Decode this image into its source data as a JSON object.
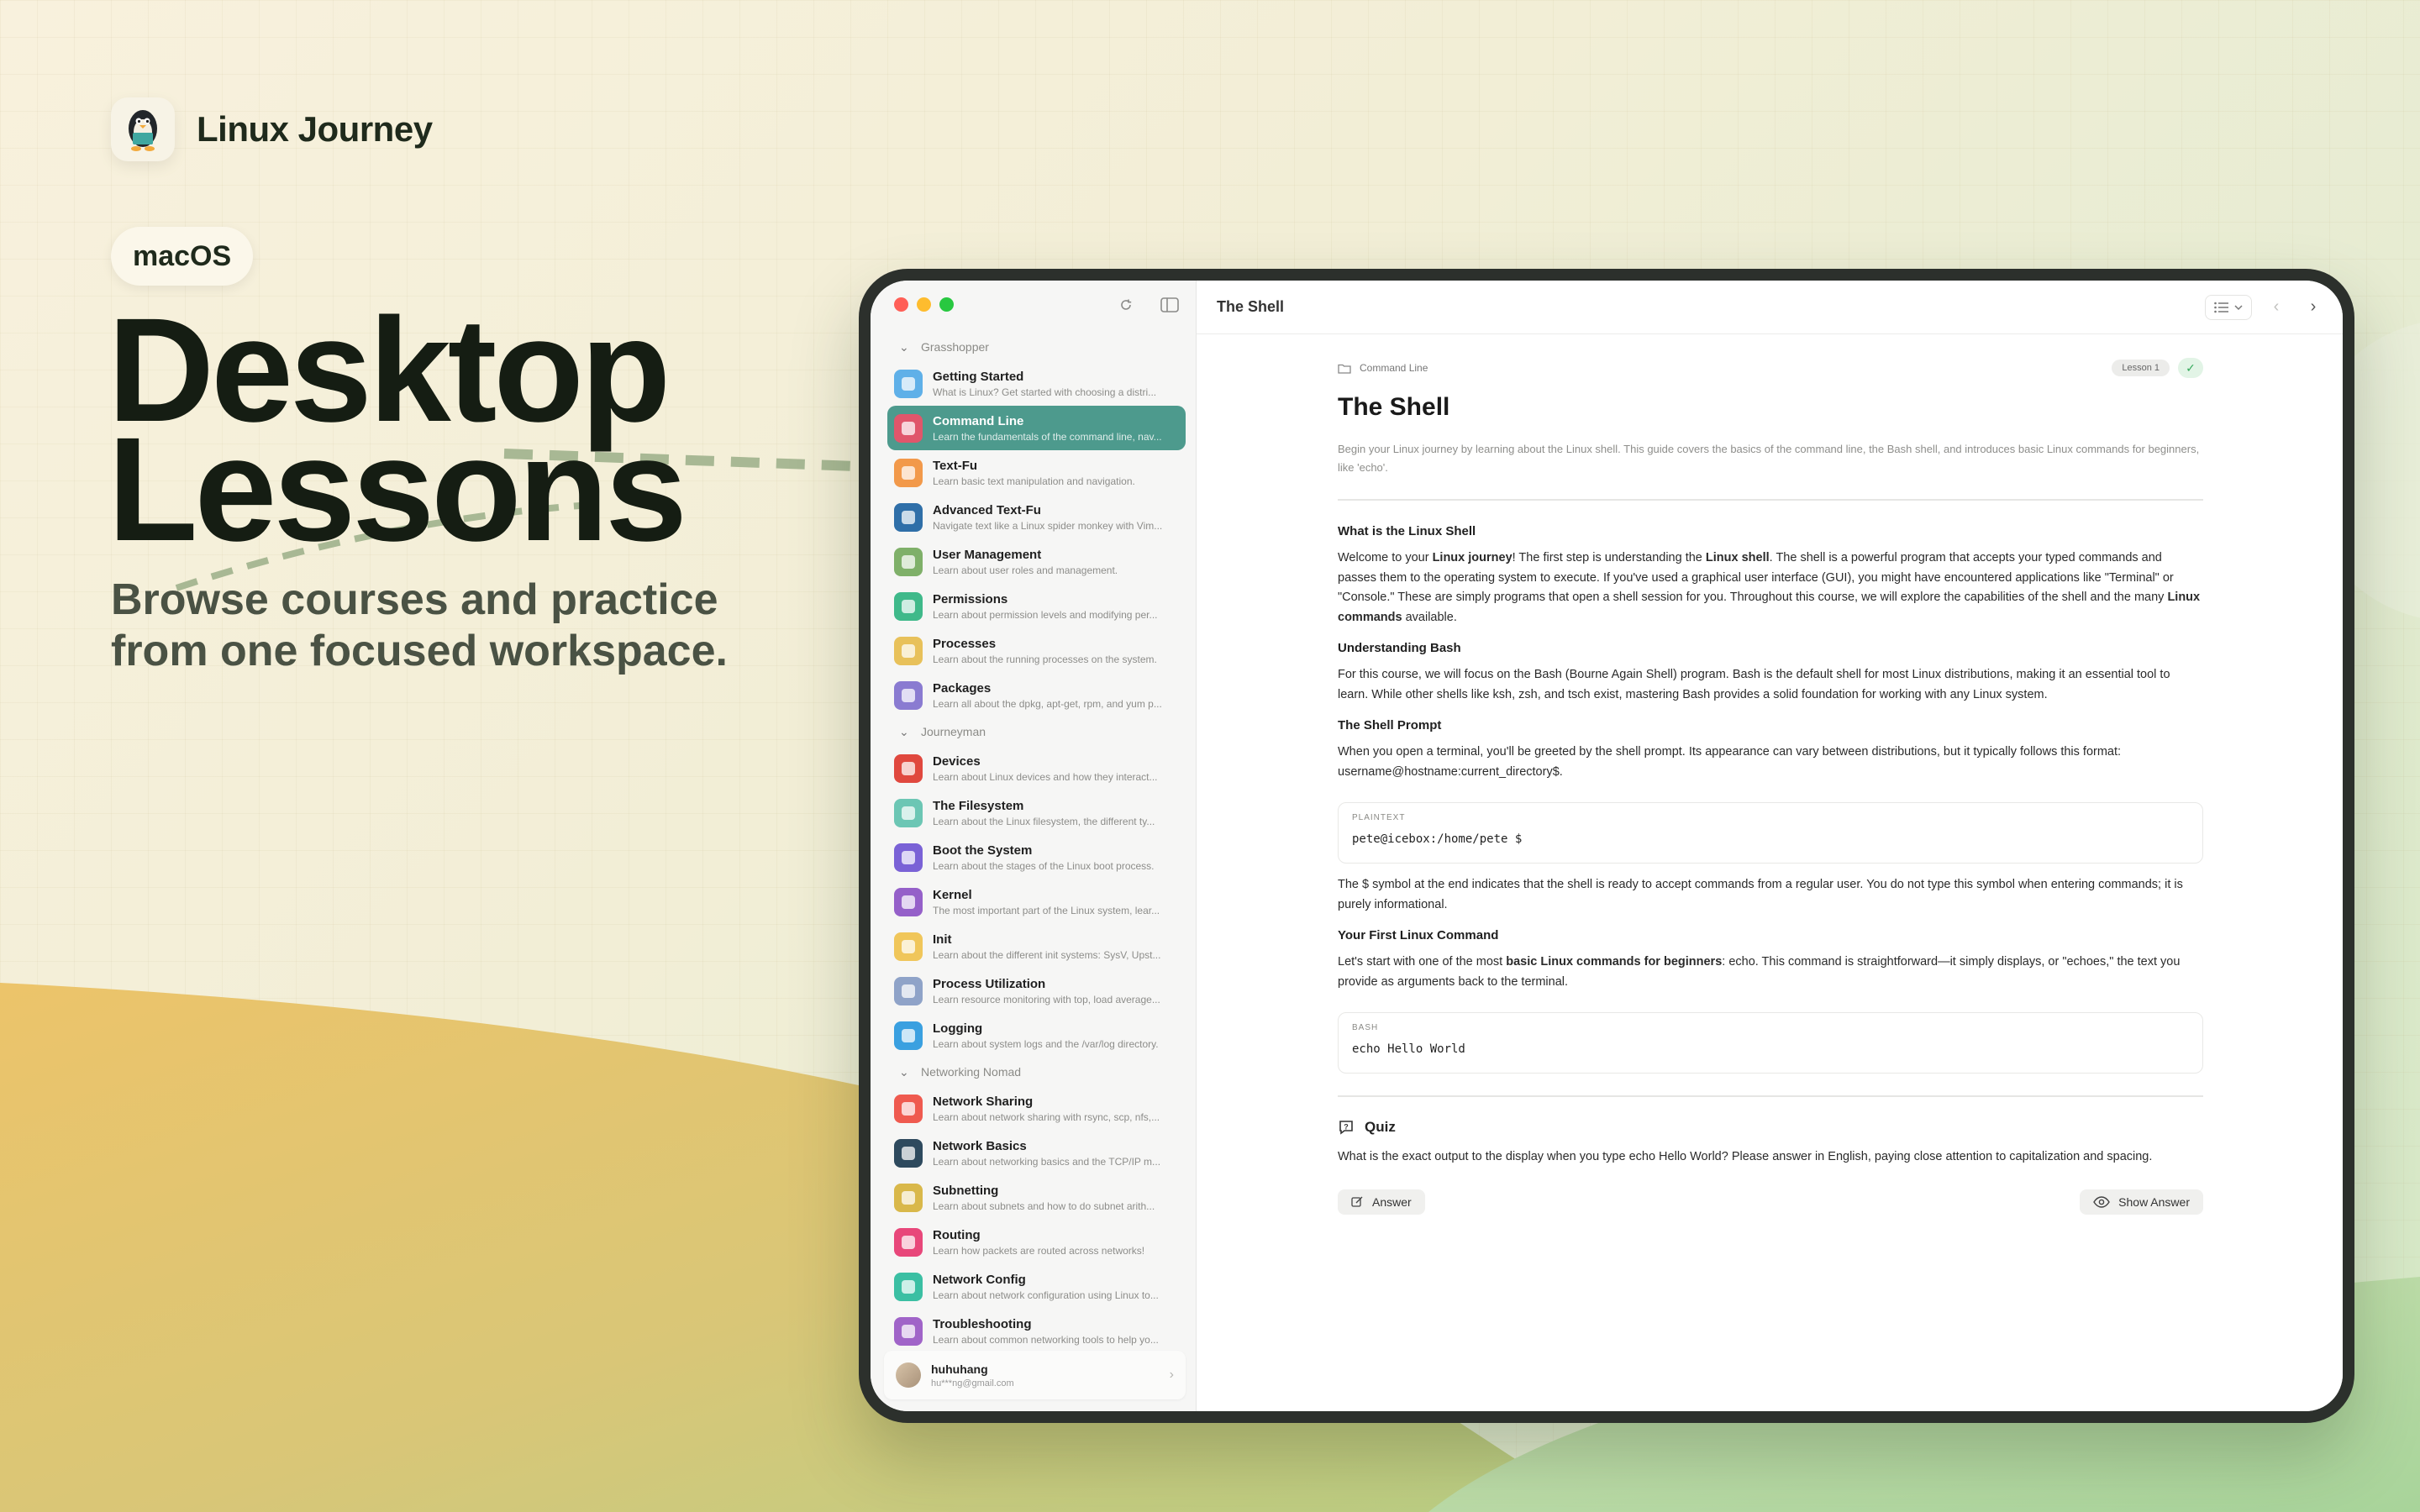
{
  "brand": {
    "name": "Linux Journey",
    "logo_icon": "penguin-icon"
  },
  "platform_badge": "macOS",
  "hero": {
    "title_line1": "Desktop",
    "title_line2": "Lessons",
    "subtitle": "Browse courses and practice from one focused workspace."
  },
  "sidebar": {
    "groups": [
      {
        "name": "Grasshopper",
        "lessons": [
          {
            "title": "Getting Started",
            "desc": "What is Linux? Get started with choosing a distri...",
            "color": "#5fb0e8"
          },
          {
            "title": "Command Line",
            "desc": "Learn the fundamentals of the command line, nav...",
            "color": "#e0566b",
            "active": true
          },
          {
            "title": "Text-Fu",
            "desc": "Learn basic text manipulation and navigation.",
            "color": "#f2994a"
          },
          {
            "title": "Advanced Text-Fu",
            "desc": "Navigate text like a Linux spider monkey with Vim...",
            "color": "#2f6fa8"
          },
          {
            "title": "User Management",
            "desc": "Learn about user roles and management.",
            "color": "#7fb069"
          },
          {
            "title": "Permissions",
            "desc": "Learn about permission levels and modifying per...",
            "color": "#3fb98a"
          },
          {
            "title": "Processes",
            "desc": "Learn about the running processes on the system.",
            "color": "#e8c15a"
          },
          {
            "title": "Packages",
            "desc": "Learn all about the dpkg, apt-get, rpm, and yum p...",
            "color": "#8a7bd1"
          }
        ]
      },
      {
        "name": "Journeyman",
        "lessons": [
          {
            "title": "Devices",
            "desc": "Learn about Linux devices and how they interact...",
            "color": "#e0483e"
          },
          {
            "title": "The Filesystem",
            "desc": "Learn about the Linux filesystem, the different ty...",
            "color": "#6cc6b4"
          },
          {
            "title": "Boot the System",
            "desc": "Learn about the stages of the Linux boot process.",
            "color": "#7a62d6"
          },
          {
            "title": "Kernel",
            "desc": "The most important part of the Linux system, lear...",
            "color": "#9560c9"
          },
          {
            "title": "Init",
            "desc": "Learn about the different init systems: SysV, Upst...",
            "color": "#f0c65a"
          },
          {
            "title": "Process Utilization",
            "desc": "Learn resource monitoring with top, load average...",
            "color": "#8fa3c8"
          },
          {
            "title": "Logging",
            "desc": "Learn about system logs and the /var/log directory.",
            "color": "#3aa0e0"
          }
        ]
      },
      {
        "name": "Networking Nomad",
        "lessons": [
          {
            "title": "Network Sharing",
            "desc": "Learn about network sharing with rsync, scp, nfs,...",
            "color": "#ef5a4f"
          },
          {
            "title": "Network Basics",
            "desc": "Learn about networking basics and the TCP/IP m...",
            "color": "#2e4a5e"
          },
          {
            "title": "Subnetting",
            "desc": "Learn about subnets and how to do subnet arith...",
            "color": "#d9b84a"
          },
          {
            "title": "Routing",
            "desc": "Learn how packets are routed across networks!",
            "color": "#e8477a"
          },
          {
            "title": "Network Config",
            "desc": "Learn about network configuration using Linux to...",
            "color": "#3bbfa3"
          },
          {
            "title": "Troubleshooting",
            "desc": "Learn about common networking tools to help yo...",
            "color": "#a064c8"
          }
        ]
      }
    ],
    "user": {
      "name": "huhuhang",
      "email": "hu***ng@gmail.com"
    }
  },
  "topbar": {
    "title": "The Shell"
  },
  "article": {
    "breadcrumb": "Command Line",
    "lesson_badge": "Lesson 1",
    "done_mark": "✓",
    "title": "The Shell",
    "intro": "Begin your Linux journey by learning about the Linux shell. This guide covers the basics of the command line, the Bash shell, and introduces basic Linux commands for beginners, like 'echo'.",
    "h_what": "What is the Linux Shell",
    "p_what_1": "Welcome to your ",
    "p_what_b1": "Linux journey",
    "p_what_2": "! The first step is understanding the ",
    "p_what_b2": "Linux shell",
    "p_what_3": ". The shell is a powerful program that accepts your typed commands and passes them to the operating system to execute. If you've used a graphical user interface (GUI), you might have encountered applications like \"Terminal\" or \"Console.\" These are simply programs that open a shell session for you. Throughout this course, we will explore the capabilities of the shell and the many ",
    "p_what_b3": "Linux commands",
    "p_what_4": " available.",
    "h_bash": "Understanding Bash",
    "p_bash": "For this course, we will focus on the Bash (Bourne Again Shell) program. Bash is the default shell for most Linux distributions, making it an essential tool to learn. While other shells like ksh, zsh, and tsch exist, mastering Bash provides a solid foundation for working with any Linux system.",
    "h_prompt": "The Shell Prompt",
    "p_prompt": "When you open a terminal, you'll be greeted by the shell prompt. Its appearance can vary between distributions, but it typically follows this format: username@hostname:current_directory$.",
    "code1_lang": "PLAINTEXT",
    "code1": "pete@icebox:/home/pete $",
    "p_symbol": "The $ symbol at the end indicates that the shell is ready to accept commands from a regular user. You do not type this symbol when entering commands; it is purely informational.",
    "h_first": "Your First Linux Command",
    "p_first_1": "Let's start with one of the most ",
    "p_first_b": "basic Linux commands for beginners",
    "p_first_2": ": echo. This command is straightforward—it simply displays, or \"echoes,\" the text you provide as arguments back to the terminal.",
    "code2_lang": "BASH",
    "code2": "echo Hello World",
    "quiz_title": "Quiz",
    "quiz_question": "What is the exact output to the display when you type echo Hello World? Please answer in English, paying close attention to capitalization and spacing.",
    "answer_label": "Answer",
    "show_answer_label": "Show Answer"
  }
}
